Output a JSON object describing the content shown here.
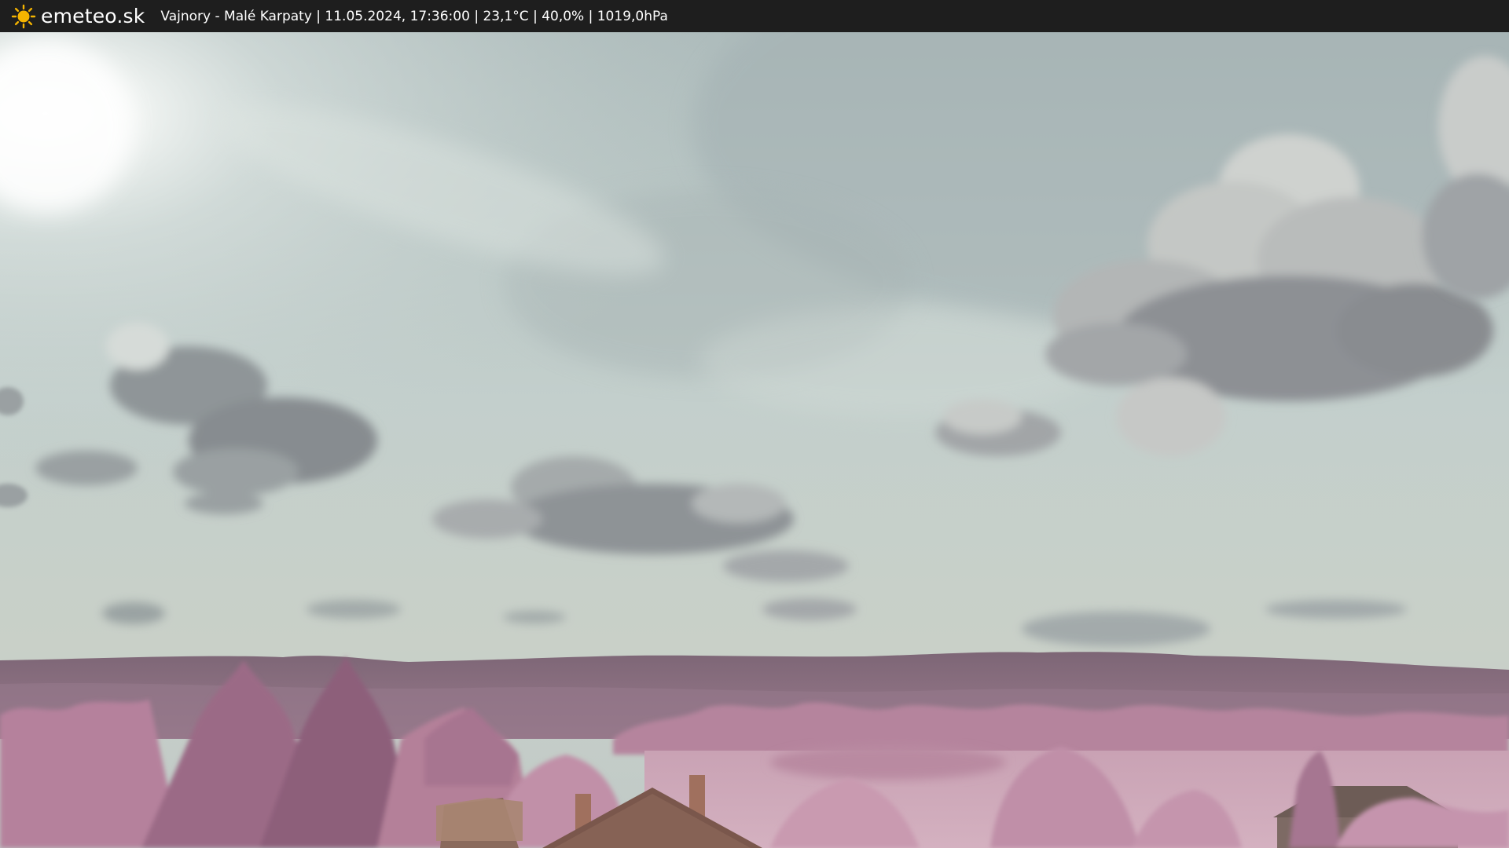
{
  "header": {
    "brand": "emeteo.sk",
    "logo_icon": "sun-icon",
    "caption": "Vajnory - Malé Karpaty | 11.05.2024, 17:36:00 | 23,1°C | 40,0% | 1019,0hPa"
  },
  "colors": {
    "bar_background": "#1e1e1e",
    "sun": "#f5b400",
    "sky": "#b9c7c6",
    "clouds": "#7d8387",
    "foliage": "#c18aa6",
    "hills": "#8a6a7e",
    "roof": "#7a5a50"
  }
}
